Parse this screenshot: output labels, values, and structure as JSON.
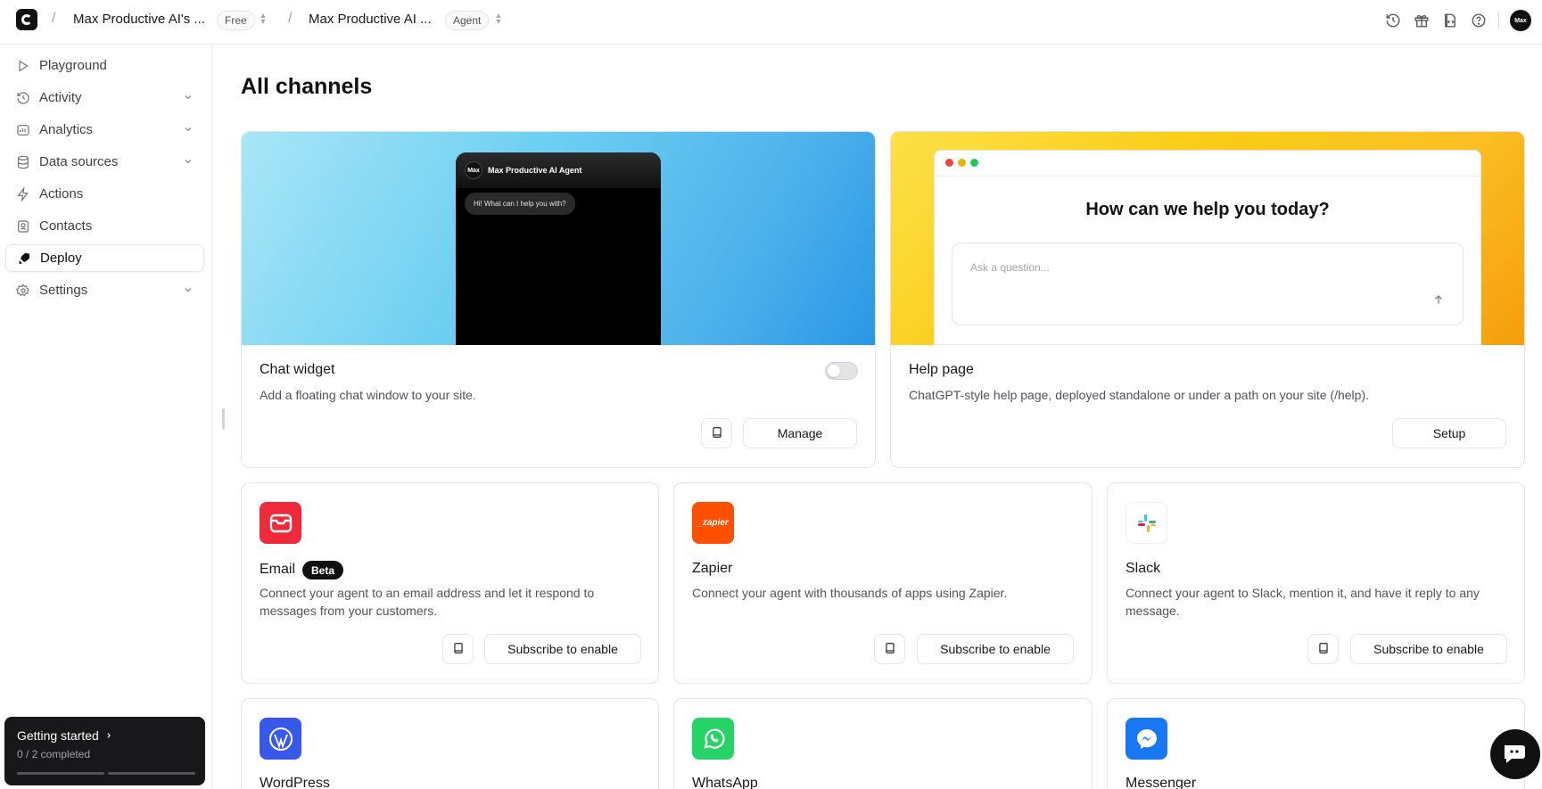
{
  "topbar": {
    "workspace": "Max Productive AI's ...",
    "workspace_plan": "Free",
    "agent": "Max Productive AI ...",
    "agent_type": "Agent",
    "avatar_text": "Max"
  },
  "sidebar": {
    "items": [
      {
        "label": "Playground",
        "icon": "play-icon"
      },
      {
        "label": "Activity",
        "icon": "activity-icon"
      },
      {
        "label": "Analytics",
        "icon": "chart-icon"
      },
      {
        "label": "Data sources",
        "icon": "database-icon"
      },
      {
        "label": "Actions",
        "icon": "bolt-icon"
      },
      {
        "label": "Contacts",
        "icon": "contact-icon"
      },
      {
        "label": "Deploy",
        "icon": "rocket-icon"
      },
      {
        "label": "Settings",
        "icon": "gear-icon"
      }
    ],
    "getting_started": {
      "title": "Getting started",
      "progress": "0 / 2 completed"
    }
  },
  "main": {
    "title": "All channels",
    "chat_widget": {
      "title": "Chat widget",
      "description": "Add a floating chat window to your site.",
      "button": "Manage",
      "preview_agent": "Max Productive AI Agent",
      "preview_avatar": "Max",
      "preview_message": "Hi! What can I help you with?",
      "enabled": false
    },
    "help_page": {
      "title": "Help page",
      "description": "ChatGPT-style help page, deployed standalone or under a path on your site (/help).",
      "button": "Setup",
      "preview_heading": "How can we help you today?",
      "preview_placeholder": "Ask a question..."
    },
    "email": {
      "title": "Email",
      "badge": "Beta",
      "description": "Connect your agent to an email address and let it respond to messages from your customers.",
      "button": "Subscribe to enable"
    },
    "zapier": {
      "title": "Zapier",
      "logo_text": "_zapier",
      "description": "Connect your agent with thousands of apps using Zapier.",
      "button": "Subscribe to enable"
    },
    "slack": {
      "title": "Slack",
      "description": "Connect your agent to Slack, mention it, and have it reply to any message.",
      "button": "Subscribe to enable"
    },
    "wordpress": {
      "title": "WordPress"
    },
    "whatsapp": {
      "title": "WhatsApp"
    },
    "messenger": {
      "title": "Messenger"
    }
  },
  "colors": {
    "email_tile": "#ef2b3b",
    "zapier_tile": "#ff4f00",
    "wordpress_tile": "#3858e9",
    "whatsapp_tile": "#25d366",
    "messenger_tile": "#1877f2"
  }
}
